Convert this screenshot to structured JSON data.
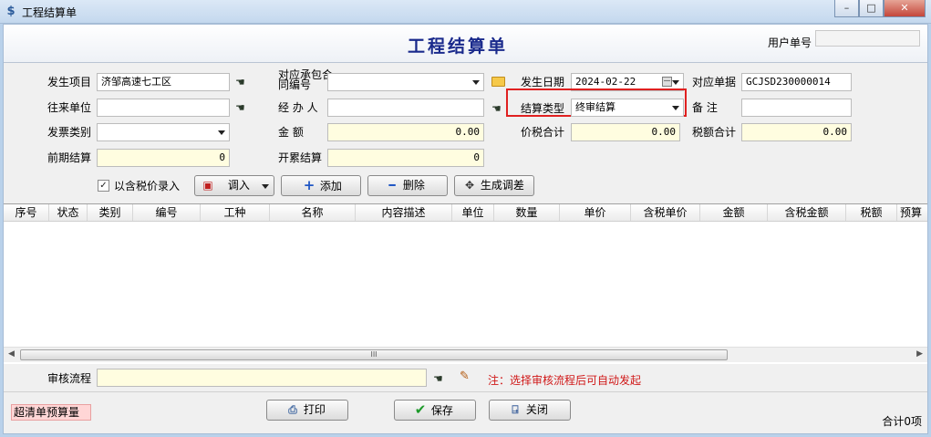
{
  "window": {
    "title": "工程结算单",
    "min_icon": "minimize-icon",
    "max_icon": "maximize-icon",
    "close_icon": "close-icon"
  },
  "header": {
    "title": "工程结算单",
    "user_no_label": "用户单号",
    "user_no_value": ""
  },
  "form": {
    "project": {
      "label": "发生项目",
      "value": "济邹高速七工区"
    },
    "partner": {
      "label": "往来单位",
      "value": ""
    },
    "invoice_type": {
      "label": "发票类别",
      "value": ""
    },
    "prev_settle": {
      "label": "前期结算",
      "value": "0"
    },
    "contract_no": {
      "label": "对应承包合同编号",
      "value": ""
    },
    "handler": {
      "label": "经 办 人",
      "value": ""
    },
    "amount": {
      "label": "金     额",
      "value": "0.00"
    },
    "cumulative": {
      "label": "开累结算",
      "value": "0"
    },
    "date": {
      "label": "发生日期",
      "value": "2024-02-22"
    },
    "settle_type": {
      "label": "结算类型",
      "value": "终审结算"
    },
    "tax_total": {
      "label": "价税合计",
      "value": "0.00"
    },
    "ref_doc": {
      "label": "对应单据",
      "value": "GCJSD230000014"
    },
    "remark": {
      "label": "备     注",
      "value": ""
    },
    "tax_amount": {
      "label": "税额合计",
      "value": "0.00"
    }
  },
  "toolbar": {
    "tax_checkbox_label": "以含税价录入",
    "tax_checked": true,
    "import_label": "调入",
    "add_label": "添加",
    "delete_label": "删除",
    "generate_label": "生成调差"
  },
  "grid": {
    "columns": [
      "序号",
      "状态",
      "类别",
      "编号",
      "工种",
      "名称",
      "内容描述",
      "单位",
      "数量",
      "单价",
      "含税单价",
      "金额",
      "含税金额",
      "税额",
      "预算"
    ],
    "rows": [],
    "scroll_grip": "III"
  },
  "audit": {
    "label": "审核流程",
    "value": "",
    "note": "注：选择审核流程后可自动发起"
  },
  "footer": {
    "warn_tag": "超清单预算量",
    "print_label": "打印",
    "save_label": "保存",
    "close_label": "关闭",
    "total_text": "合计0项"
  },
  "colors": {
    "accent_title": "#1a2a8c",
    "highlight_box": "#e02020",
    "note_red": "#d01818",
    "warn_bg": "#ffd6d6"
  }
}
